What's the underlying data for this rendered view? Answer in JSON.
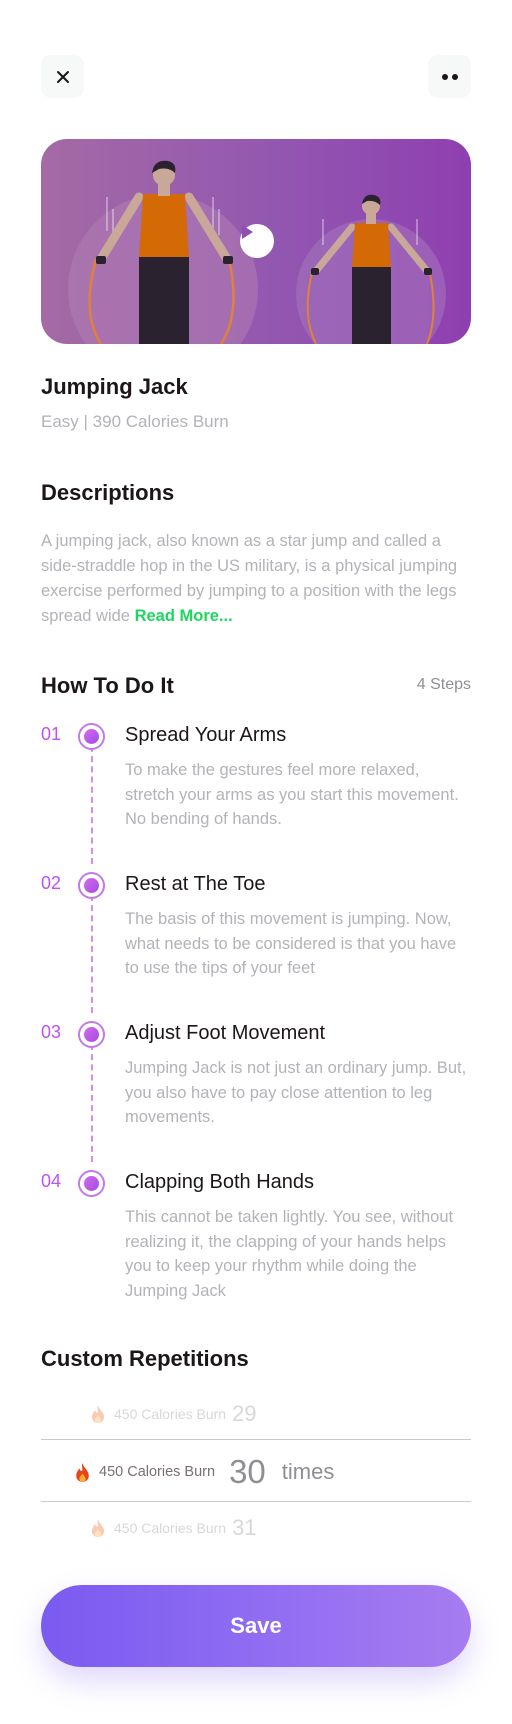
{
  "header": {
    "close_icon": "close-icon",
    "more_icon": "more-dots-icon"
  },
  "workout": {
    "title": "Jumping Jack",
    "subtitle": "Easy | 390 Calories Burn"
  },
  "descriptions": {
    "heading": "Descriptions",
    "text": "A jumping jack, also known as a star jump and called a side-straddle hop in the US military, is a physical jumping exercise performed by jumping to a position with the legs spread wide ",
    "read_more": "Read More..."
  },
  "how_to": {
    "heading": "How To Do It",
    "steps_count": "4 Steps",
    "steps": [
      {
        "num": "01",
        "title": "Spread Your Arms",
        "desc": "To make the gestures feel more relaxed, stretch your arms as you start this movement. No bending of hands."
      },
      {
        "num": "02",
        "title": "Rest at The Toe",
        "desc": "The basis of this movement is jumping. Now, what needs to be considered is that you have to use the tips of your feet"
      },
      {
        "num": "03",
        "title": "Adjust Foot Movement",
        "desc": "Jumping Jack is not just an ordinary jump. But, you also have to pay close attention to leg movements."
      },
      {
        "num": "04",
        "title": "Clapping Both Hands",
        "desc": "This cannot be taken lightly. You see, without realizing it, the clapping of your hands helps you to keep your rhythm while doing the Jumping Jack"
      }
    ]
  },
  "repetitions": {
    "heading": "Custom Repetitions",
    "rows": [
      {
        "calories": "450 Calories Burn",
        "value": "29",
        "unit": ""
      },
      {
        "calories": "450 Calories Burn",
        "value": "30",
        "unit": "times"
      },
      {
        "calories": "450 Calories Burn",
        "value": "31",
        "unit": ""
      }
    ],
    "selected_index": 1
  },
  "actions": {
    "save_label": "Save"
  },
  "colors": {
    "accent_purple": "#c150f6",
    "read_more_green": "#1ed760",
    "button_gradient_start": "#7a5bf0",
    "button_gradient_end": "#a77cf0"
  }
}
